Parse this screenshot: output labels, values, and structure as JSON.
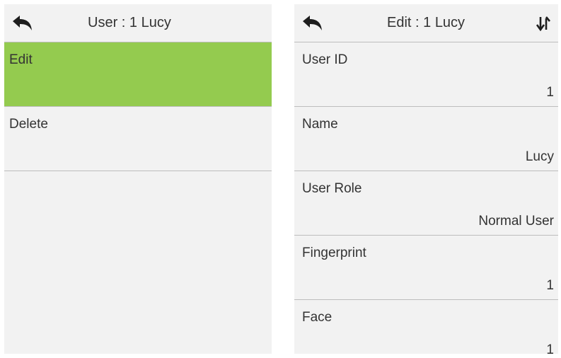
{
  "left": {
    "title": "User : 1 Lucy",
    "menu": [
      {
        "label": "Edit",
        "selected": true
      },
      {
        "label": "Delete",
        "selected": false
      }
    ]
  },
  "right": {
    "title": "Edit : 1 Lucy",
    "fields": [
      {
        "label": "User ID",
        "value": "1"
      },
      {
        "label": "Name",
        "value": "Lucy"
      },
      {
        "label": "User Role",
        "value": "Normal User"
      },
      {
        "label": "Fingerprint",
        "value": "1"
      },
      {
        "label": "Face",
        "value": "1"
      }
    ]
  },
  "colors": {
    "selected_bg": "#94cb4f",
    "screen_bg": "#f2f2f2",
    "divider": "#bdbdbd"
  },
  "icons": {
    "back": "back-arrow-icon",
    "sort": "sort-arrows-icon"
  }
}
